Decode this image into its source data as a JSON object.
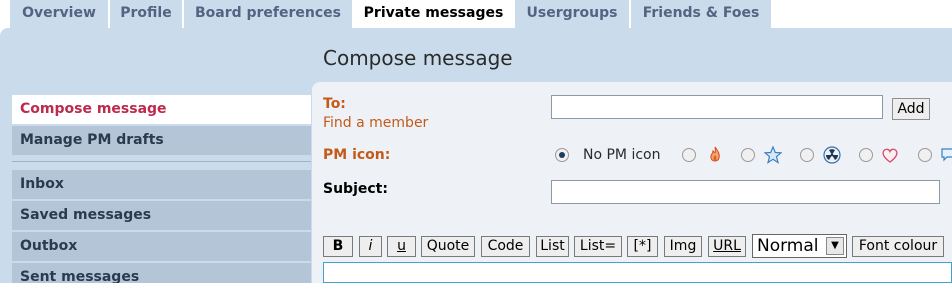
{
  "tabs": [
    {
      "label": "Overview"
    },
    {
      "label": "Profile"
    },
    {
      "label": "Board preferences"
    },
    {
      "label": "Private messages"
    },
    {
      "label": "Usergroups"
    },
    {
      "label": "Friends & Foes"
    }
  ],
  "sidebar": {
    "items": [
      {
        "label": "Compose message"
      },
      {
        "label": "Manage PM drafts"
      },
      {
        "label": "Inbox"
      },
      {
        "label": "Saved messages"
      },
      {
        "label": "Outbox"
      },
      {
        "label": "Sent messages"
      }
    ]
  },
  "compose": {
    "heading": "Compose message",
    "to_label": "To:",
    "find_member_link": "Find a member",
    "to_value": "",
    "add_button": "Add",
    "pm_icon_label": "PM icon:",
    "no_pm_icon_label": "No PM icon",
    "subject_label": "Subject:",
    "subject_value": ""
  },
  "toolbar": {
    "buttons": [
      "B",
      "i",
      "u",
      "Quote",
      "Code",
      "List",
      "List=",
      "[*]",
      "Img",
      "URL"
    ],
    "font_size_selected": "Normal",
    "font_colour_button": "Font colour"
  },
  "colors": {
    "accent_red": "#bc2a4d",
    "label_orange": "#c35a1a",
    "panel_blue": "#cadceb"
  }
}
